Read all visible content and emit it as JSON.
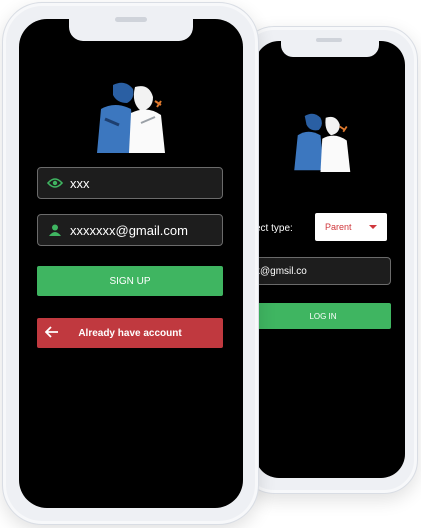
{
  "front": {
    "name_value": "xxx",
    "email_value": "xxxxxxx@gmail.com",
    "signup_label": "SIGN UP",
    "have_account_label": "Already have account"
  },
  "back": {
    "select_type_label": "ect type:",
    "select_value": "Parent",
    "email_value": "x@gmsil.co",
    "login_label": "LOG IN"
  },
  "colors": {
    "green": "#3fb561",
    "red": "#c0393f",
    "screen": "#000000",
    "field_bg": "#1d1d1d"
  },
  "icons": [
    "eye-icon",
    "person-icon",
    "arrow-left-icon",
    "caret-down-icon"
  ]
}
